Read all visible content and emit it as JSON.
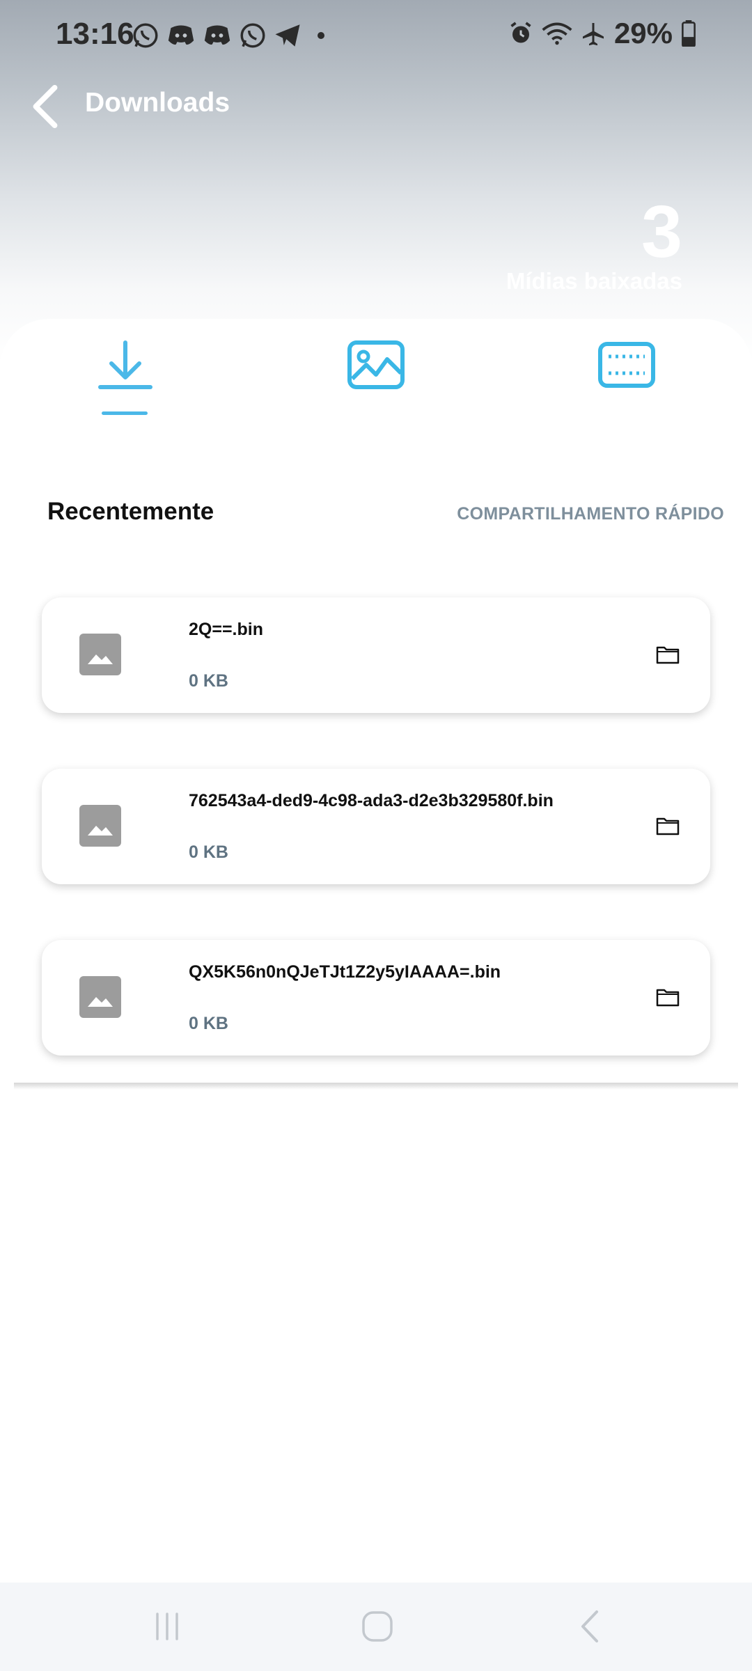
{
  "status_bar": {
    "time": "13:16",
    "battery": "29%",
    "left_icons": [
      "whatsapp-icon",
      "discord-icon",
      "discord-icon",
      "whatsapp-icon",
      "telegram-icon"
    ],
    "right_icons": [
      "alarm-icon",
      "wifi-icon",
      "airplane-mode-icon",
      "battery-icon"
    ]
  },
  "header": {
    "title": "Downloads",
    "media_count": "3",
    "media_count_label": "Mídias baixadas"
  },
  "tabs": [
    {
      "icon": "download-icon",
      "selected": true
    },
    {
      "icon": "image-icon",
      "selected": false
    },
    {
      "icon": "sticker-icon",
      "selected": false
    }
  ],
  "section": {
    "title": "Recentemente",
    "action": "COMPARTILHAMENTO RÁPIDO"
  },
  "files": [
    {
      "name": "2Q==.bin",
      "size": "0 KB"
    },
    {
      "name": "762543a4-ded9-4c98-ada3-d2e3b329580f.bin",
      "size": "0 KB"
    },
    {
      "name": "QX5K56n0nQJeTJt1Z2y5yIAAAA=.bin",
      "size": "0 KB"
    }
  ],
  "colors": {
    "accent": "#4bb8e8",
    "header_top": "#a2aab3",
    "thumb": "#9c9c9c",
    "size_text": "#5f7382"
  }
}
